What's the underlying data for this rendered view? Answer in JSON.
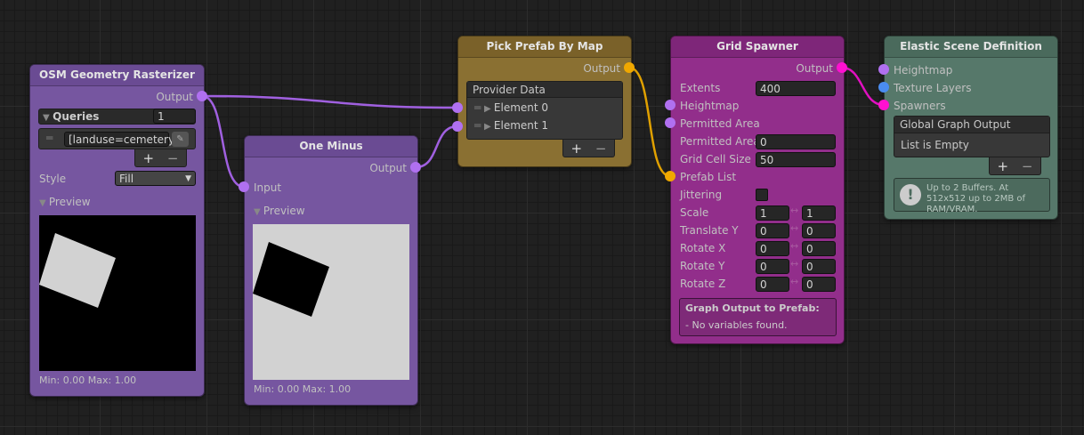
{
  "colors": {
    "purple_port": "#b070f0",
    "orange_port": "#f0a800",
    "magenta_port": "#ff10d0",
    "blue_port": "#4a8cf0"
  },
  "osm": {
    "title": "OSM Geometry Rasterizer",
    "output": "Output",
    "queries_label": "Queries",
    "queries_count": "1",
    "query": "[landuse=cemetery]",
    "plus": "+",
    "minus": "−",
    "style_label": "Style",
    "style_value": "Fill",
    "preview_label": "Preview",
    "minmax": "Min: 0.00 Max: 1.00"
  },
  "one_minus": {
    "title": "One Minus",
    "output": "Output",
    "input": "Input",
    "preview_label": "Preview",
    "minmax": "Min: 0.00 Max: 1.00"
  },
  "pick": {
    "title": "Pick Prefab By Map",
    "output": "Output",
    "list_header": "Provider Data",
    "elements": [
      "Element 0",
      "Element 1"
    ],
    "plus": "+",
    "minus": "−"
  },
  "grid": {
    "title": "Grid Spawner",
    "output": "Output",
    "extents_label": "Extents",
    "extents": "400",
    "heightmap": "Heightmap",
    "permitted_area_port": "Permitted Area",
    "permitted_area_label": "Permitted Area",
    "permitted_area": "0",
    "cell_label": "Grid Cell Size",
    "cell": "50",
    "prefab_list": "Prefab List",
    "jittering": "Jittering",
    "jittering_checked": false,
    "ranges": [
      {
        "label": "Scale",
        "min": "1",
        "max": "1"
      },
      {
        "label": "Translate Y",
        "min": "0",
        "max": "0"
      },
      {
        "label": "Rotate X",
        "min": "0",
        "max": "0"
      },
      {
        "label": "Rotate Y",
        "min": "0",
        "max": "0"
      },
      {
        "label": "Rotate Z",
        "min": "0",
        "max": "0"
      }
    ],
    "vars_title": "Graph Output to Prefab:",
    "vars_text": "- No variables found."
  },
  "elastic": {
    "title": "Elastic Scene Definition",
    "inputs": [
      "Heightmap",
      "Texture Layers",
      "Spawners"
    ],
    "list_header": "Global Graph Output",
    "list_empty": "List is Empty",
    "plus": "+",
    "minus": "−",
    "info": "Up to 2 Buffers. At 512x512 up to 2MB of RAM/VRAM."
  }
}
